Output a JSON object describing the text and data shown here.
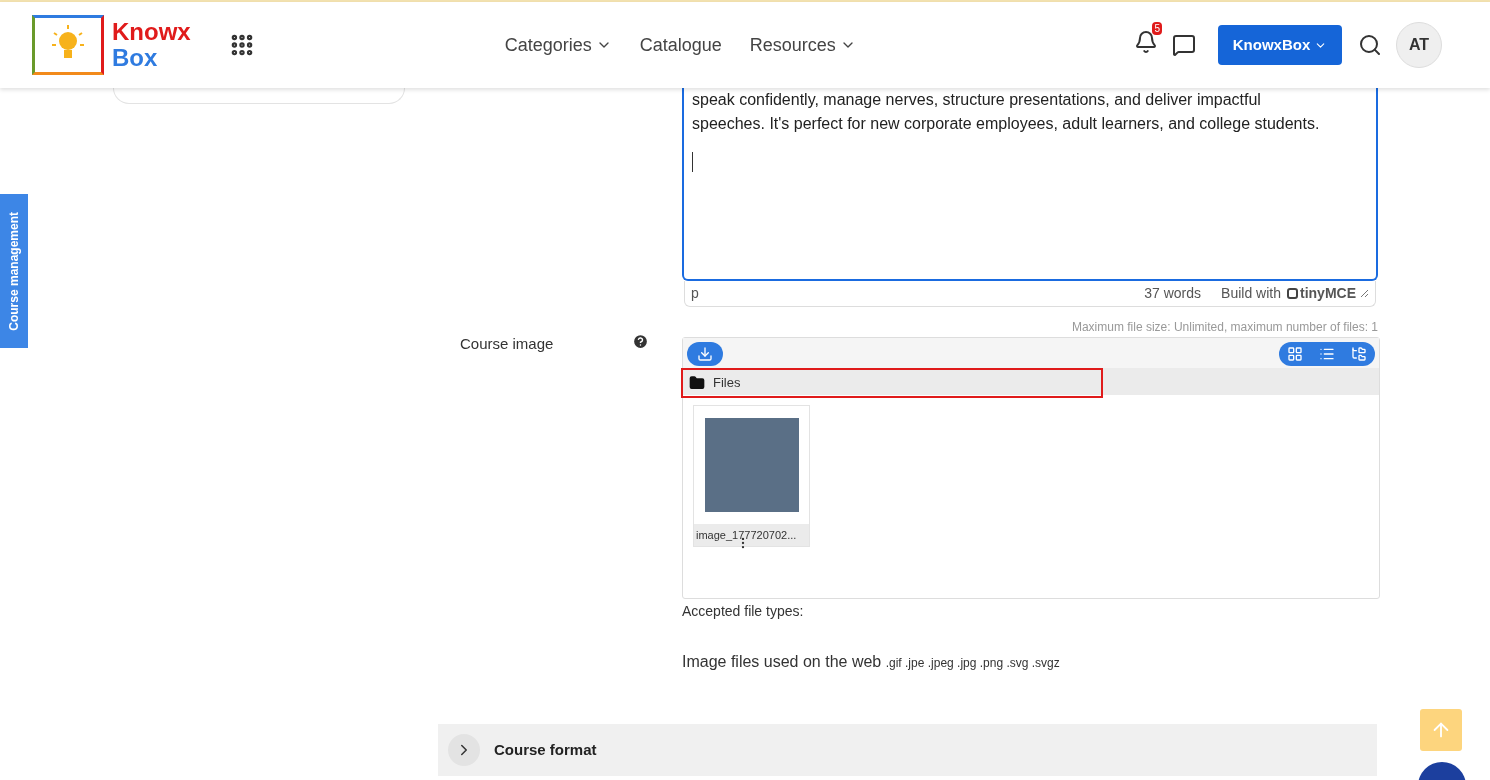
{
  "header": {
    "logo": {
      "line1": "Knowx",
      "line2": "Box"
    },
    "nav": [
      {
        "label": "Categories",
        "dropdown": true
      },
      {
        "label": "Catalogue",
        "dropdown": false
      },
      {
        "label": "Resources",
        "dropdown": true
      }
    ],
    "notifications": {
      "count": "5"
    },
    "brand_button": "KnowxBox",
    "avatar": "AT"
  },
  "side_tab": "Course management",
  "editor": {
    "lines": [
      "speak confidently, manage nerves, structure presentations, and deliver impactful",
      "speeches. It's perfect for new corporate employees, adult learners, and college students."
    ],
    "path": "p",
    "word_count": "37 words",
    "brand_prefix": "Build with",
    "brand": "tinyMCE"
  },
  "course_image": {
    "label": "Course image",
    "limits": "Maximum file size: Unlimited, maximum number of files: 1",
    "folder": {
      "label": "Files",
      "highlighted": true
    },
    "files": [
      {
        "name": "image_177720702..."
      }
    ],
    "accepted_label": "Accepted file types:",
    "accepted_desc": "Image files used on the web",
    "accepted_ext": ".gif .jpe .jpeg .jpg .png .svg .svgz"
  },
  "sections": [
    {
      "title": "Course format",
      "expanded": false
    }
  ]
}
